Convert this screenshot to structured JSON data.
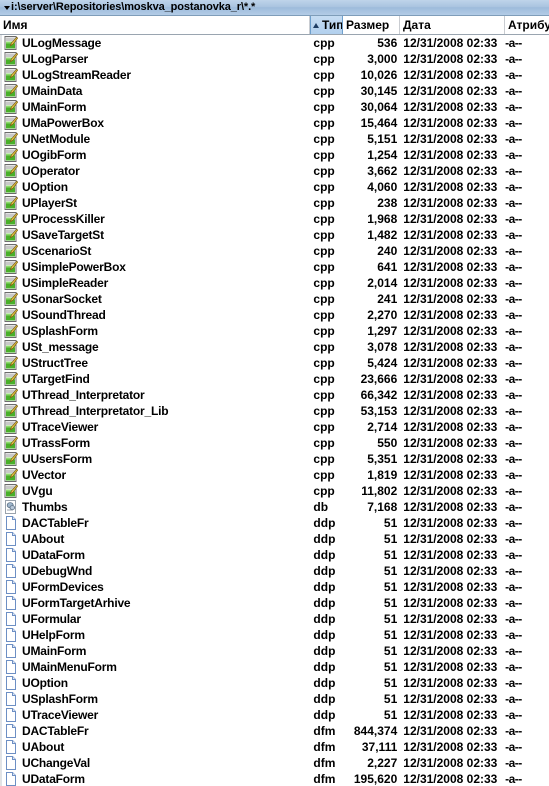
{
  "window": {
    "path": "i:\\server\\Repositories\\moskva_postanovka_r\\*.*",
    "dropdown_icon": "chevron-down-icon"
  },
  "colors": {
    "pathbar_bg": "#aac4e0",
    "sorted_header_bg": "#b2d0ee",
    "header_border": "#9aa5b0",
    "text": "#000000"
  },
  "columns": [
    {
      "key": "name",
      "label": "Имя",
      "sorted": false
    },
    {
      "key": "type",
      "label": "Тип",
      "sorted": true,
      "sort_dir": "asc"
    },
    {
      "key": "size",
      "label": "Размер",
      "sorted": false
    },
    {
      "key": "date",
      "label": "Дата",
      "sorted": false
    },
    {
      "key": "attr",
      "label": "Атрибуты",
      "sorted": false
    }
  ],
  "files": [
    {
      "icon": "cpp-file-icon",
      "name": "ULogMessage",
      "type": "cpp",
      "size": "536",
      "date": "12/31/2008 02:33",
      "attr": "-a--"
    },
    {
      "icon": "cpp-file-icon",
      "name": "ULogParser",
      "type": "cpp",
      "size": "3,000",
      "date": "12/31/2008 02:33",
      "attr": "-a--"
    },
    {
      "icon": "cpp-file-icon",
      "name": "ULogStreamReader",
      "type": "cpp",
      "size": "10,026",
      "date": "12/31/2008 02:33",
      "attr": "-a--"
    },
    {
      "icon": "cpp-file-icon",
      "name": "UMainData",
      "type": "cpp",
      "size": "30,145",
      "date": "12/31/2008 02:33",
      "attr": "-a--"
    },
    {
      "icon": "cpp-file-icon",
      "name": "UMainForm",
      "type": "cpp",
      "size": "30,064",
      "date": "12/31/2008 02:33",
      "attr": "-a--"
    },
    {
      "icon": "cpp-file-icon",
      "name": "UMaPowerBox",
      "type": "cpp",
      "size": "15,464",
      "date": "12/31/2008 02:33",
      "attr": "-a--"
    },
    {
      "icon": "cpp-file-icon",
      "name": "UNetModule",
      "type": "cpp",
      "size": "5,151",
      "date": "12/31/2008 02:33",
      "attr": "-a--"
    },
    {
      "icon": "cpp-file-icon",
      "name": "UOgibForm",
      "type": "cpp",
      "size": "1,254",
      "date": "12/31/2008 02:33",
      "attr": "-a--"
    },
    {
      "icon": "cpp-file-icon",
      "name": "UOperator",
      "type": "cpp",
      "size": "3,662",
      "date": "12/31/2008 02:33",
      "attr": "-a--"
    },
    {
      "icon": "cpp-file-icon",
      "name": "UOption",
      "type": "cpp",
      "size": "4,060",
      "date": "12/31/2008 02:33",
      "attr": "-a--"
    },
    {
      "icon": "cpp-file-icon",
      "name": "UPlayerSt",
      "type": "cpp",
      "size": "238",
      "date": "12/31/2008 02:33",
      "attr": "-a--"
    },
    {
      "icon": "cpp-file-icon",
      "name": "UProcessKiller",
      "type": "cpp",
      "size": "1,968",
      "date": "12/31/2008 02:33",
      "attr": "-a--"
    },
    {
      "icon": "cpp-file-icon",
      "name": "USaveTargetSt",
      "type": "cpp",
      "size": "1,482",
      "date": "12/31/2008 02:33",
      "attr": "-a--"
    },
    {
      "icon": "cpp-file-icon",
      "name": "UScenarioSt",
      "type": "cpp",
      "size": "240",
      "date": "12/31/2008 02:33",
      "attr": "-a--"
    },
    {
      "icon": "cpp-file-icon",
      "name": "USimplePowerBox",
      "type": "cpp",
      "size": "641",
      "date": "12/31/2008 02:33",
      "attr": "-a--"
    },
    {
      "icon": "cpp-file-icon",
      "name": "USimpleReader",
      "type": "cpp",
      "size": "2,014",
      "date": "12/31/2008 02:33",
      "attr": "-a--"
    },
    {
      "icon": "cpp-file-icon",
      "name": "USonarSocket",
      "type": "cpp",
      "size": "241",
      "date": "12/31/2008 02:33",
      "attr": "-a--"
    },
    {
      "icon": "cpp-file-icon",
      "name": "USoundThread",
      "type": "cpp",
      "size": "2,270",
      "date": "12/31/2008 02:33",
      "attr": "-a--"
    },
    {
      "icon": "cpp-file-icon",
      "name": "USplashForm",
      "type": "cpp",
      "size": "1,297",
      "date": "12/31/2008 02:33",
      "attr": "-a--"
    },
    {
      "icon": "cpp-file-icon",
      "name": "USt_message",
      "type": "cpp",
      "size": "3,078",
      "date": "12/31/2008 02:33",
      "attr": "-a--"
    },
    {
      "icon": "cpp-file-icon",
      "name": "UStructTree",
      "type": "cpp",
      "size": "5,424",
      "date": "12/31/2008 02:33",
      "attr": "-a--"
    },
    {
      "icon": "cpp-file-icon",
      "name": "UTargetFind",
      "type": "cpp",
      "size": "23,666",
      "date": "12/31/2008 02:33",
      "attr": "-a--"
    },
    {
      "icon": "cpp-file-icon",
      "name": "UThread_Interpretator",
      "type": "cpp",
      "size": "66,342",
      "date": "12/31/2008 02:33",
      "attr": "-a--"
    },
    {
      "icon": "cpp-file-icon",
      "name": "UThread_Interpretator_Lib",
      "type": "cpp",
      "size": "53,153",
      "date": "12/31/2008 02:33",
      "attr": "-a--"
    },
    {
      "icon": "cpp-file-icon",
      "name": "UTraceViewer",
      "type": "cpp",
      "size": "2,714",
      "date": "12/31/2008 02:33",
      "attr": "-a--"
    },
    {
      "icon": "cpp-file-icon",
      "name": "UTrassForm",
      "type": "cpp",
      "size": "550",
      "date": "12/31/2008 02:33",
      "attr": "-a--"
    },
    {
      "icon": "cpp-file-icon",
      "name": "UUsersForm",
      "type": "cpp",
      "size": "5,351",
      "date": "12/31/2008 02:33",
      "attr": "-a--"
    },
    {
      "icon": "cpp-file-icon",
      "name": "UVector",
      "type": "cpp",
      "size": "1,819",
      "date": "12/31/2008 02:33",
      "attr": "-a--"
    },
    {
      "icon": "cpp-file-icon",
      "name": "UVgu",
      "type": "cpp",
      "size": "11,802",
      "date": "12/31/2008 02:33",
      "attr": "-a--"
    },
    {
      "icon": "db-file-icon",
      "name": "Thumbs",
      "type": "db",
      "size": "7,168",
      "date": "12/31/2008 02:33",
      "attr": "-a--"
    },
    {
      "icon": "blank-file-icon",
      "name": "DACTableFr",
      "type": "ddp",
      "size": "51",
      "date": "12/31/2008 02:33",
      "attr": "-a--"
    },
    {
      "icon": "blank-file-icon",
      "name": "UAbout",
      "type": "ddp",
      "size": "51",
      "date": "12/31/2008 02:33",
      "attr": "-a--"
    },
    {
      "icon": "blank-file-icon",
      "name": "UDataForm",
      "type": "ddp",
      "size": "51",
      "date": "12/31/2008 02:33",
      "attr": "-a--"
    },
    {
      "icon": "blank-file-icon",
      "name": "UDebugWnd",
      "type": "ddp",
      "size": "51",
      "date": "12/31/2008 02:33",
      "attr": "-a--"
    },
    {
      "icon": "blank-file-icon",
      "name": "UFormDevices",
      "type": "ddp",
      "size": "51",
      "date": "12/31/2008 02:33",
      "attr": "-a--"
    },
    {
      "icon": "blank-file-icon",
      "name": "UFormTargetArhive",
      "type": "ddp",
      "size": "51",
      "date": "12/31/2008 02:33",
      "attr": "-a--"
    },
    {
      "icon": "blank-file-icon",
      "name": "UFormular",
      "type": "ddp",
      "size": "51",
      "date": "12/31/2008 02:33",
      "attr": "-a--"
    },
    {
      "icon": "blank-file-icon",
      "name": "UHelpForm",
      "type": "ddp",
      "size": "51",
      "date": "12/31/2008 02:33",
      "attr": "-a--"
    },
    {
      "icon": "blank-file-icon",
      "name": "UMainForm",
      "type": "ddp",
      "size": "51",
      "date": "12/31/2008 02:33",
      "attr": "-a--"
    },
    {
      "icon": "blank-file-icon",
      "name": "UMainMenuForm",
      "type": "ddp",
      "size": "51",
      "date": "12/31/2008 02:33",
      "attr": "-a--"
    },
    {
      "icon": "blank-file-icon",
      "name": "UOption",
      "type": "ddp",
      "size": "51",
      "date": "12/31/2008 02:33",
      "attr": "-a--"
    },
    {
      "icon": "blank-file-icon",
      "name": "USplashForm",
      "type": "ddp",
      "size": "51",
      "date": "12/31/2008 02:33",
      "attr": "-a--"
    },
    {
      "icon": "blank-file-icon",
      "name": "UTraceViewer",
      "type": "ddp",
      "size": "51",
      "date": "12/31/2008 02:33",
      "attr": "-a--"
    },
    {
      "icon": "blank-file-icon",
      "name": "DACTableFr",
      "type": "dfm",
      "size": "844,374",
      "date": "12/31/2008 02:33",
      "attr": "-a--"
    },
    {
      "icon": "blank-file-icon",
      "name": "UAbout",
      "type": "dfm",
      "size": "37,111",
      "date": "12/31/2008 02:33",
      "attr": "-a--"
    },
    {
      "icon": "blank-file-icon",
      "name": "UChangeVal",
      "type": "dfm",
      "size": "2,227",
      "date": "12/31/2008 02:33",
      "attr": "-a--"
    },
    {
      "icon": "blank-file-icon",
      "name": "UDataForm",
      "type": "dfm",
      "size": "195,620",
      "date": "12/31/2008 02:33",
      "attr": "-a--"
    }
  ]
}
